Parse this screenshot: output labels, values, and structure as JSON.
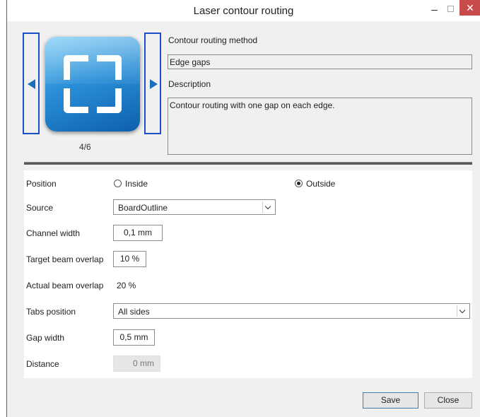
{
  "window": {
    "title": "Laser contour routing",
    "close_glyph": "✕"
  },
  "selector": {
    "counter": "4/6",
    "image_icon": "fullscreen-corners-icon",
    "accent_color": "#1a4fc8"
  },
  "method": {
    "method_label": "Contour routing method",
    "method_value": "Edge gaps",
    "description_label": "Description",
    "description_value": "Contour routing with one gap on each edge."
  },
  "form": {
    "position_label": "Position",
    "position_options": [
      "Inside",
      "Outside"
    ],
    "position_selected": "Outside",
    "source_label": "Source",
    "source_value": "BoardOutline",
    "channel_width_label": "Channel width",
    "channel_width_value": "0,1 mm",
    "target_overlap_label": "Target beam overlap",
    "target_overlap_value": "10 %",
    "actual_overlap_label": "Actual beam overlap",
    "actual_overlap_value": "20 %",
    "tabs_position_label": "Tabs position",
    "tabs_position_value": "All sides",
    "gap_width_label": "Gap width",
    "gap_width_value": "0,5 mm",
    "distance_label": "Distance",
    "distance_value": "0 mm"
  },
  "buttons": {
    "save": "Save",
    "close": "Close"
  }
}
